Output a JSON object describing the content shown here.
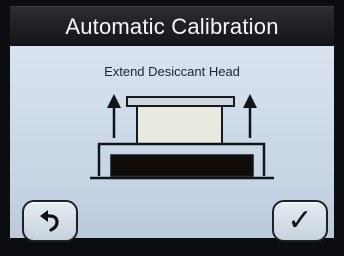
{
  "title": "Automatic Calibration",
  "instruction": "Extend Desiccant Head",
  "buttons": {
    "back_icon": "undo-arrow-icon",
    "ok_glyph": "✓",
    "ok_icon": "checkmark-icon"
  }
}
